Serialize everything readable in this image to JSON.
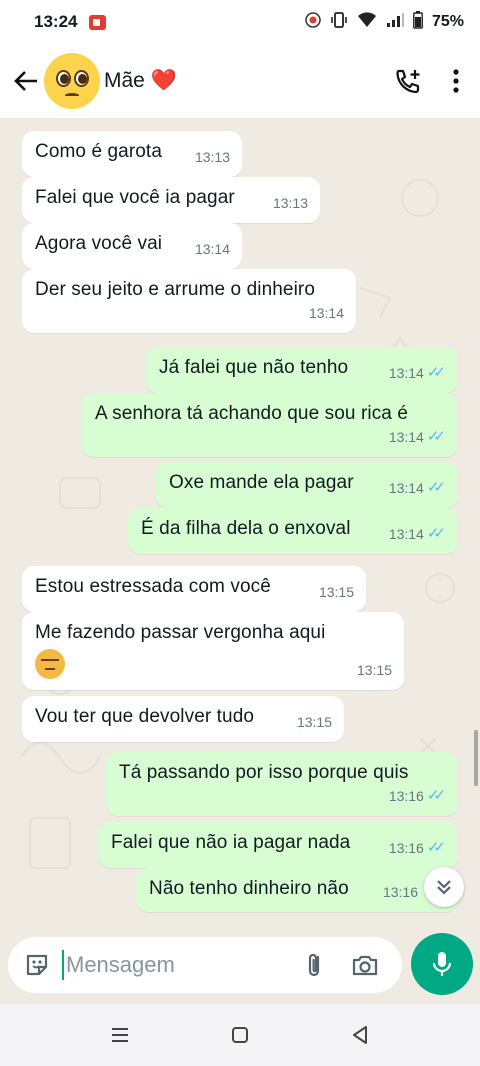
{
  "status_bar": {
    "time": "13:24",
    "battery": "75%"
  },
  "header": {
    "contact_name": "Mãe ❤️"
  },
  "messages": [
    {
      "dir": "in",
      "text": "Como é garota",
      "time": "13:13"
    },
    {
      "dir": "in",
      "text": "Falei que você ia pagar",
      "time": "13:13"
    },
    {
      "dir": "in",
      "text": "Agora você vai",
      "time": "13:14"
    },
    {
      "dir": "in",
      "text": "Der seu jeito e arrume o dinheiro",
      "time": "13:14"
    },
    {
      "dir": "out",
      "text": "Já falei que não tenho",
      "time": "13:14",
      "status": "read"
    },
    {
      "dir": "out",
      "text": "A senhora tá achando que sou rica é",
      "time": "13:14",
      "status": "read"
    },
    {
      "dir": "out",
      "text": "Oxe mande ela pagar",
      "time": "13:14",
      "status": "read"
    },
    {
      "dir": "out",
      "text": "É da filha dela o enxoval",
      "time": "13:14",
      "status": "read"
    },
    {
      "dir": "in",
      "text": "Estou estressada com você",
      "time": "13:15"
    },
    {
      "dir": "in",
      "text": "Me fazendo passar vergonha aqui",
      "emoji": "unamused-face",
      "time": "13:15"
    },
    {
      "dir": "in",
      "text": "Vou ter que devolver tudo",
      "time": "13:15"
    },
    {
      "dir": "out",
      "text": "Tá passando por isso porque quis",
      "time": "13:16",
      "status": "read"
    },
    {
      "dir": "out",
      "text": "Falei que não ia pagar nada",
      "time": "13:16",
      "status": "read"
    },
    {
      "dir": "out",
      "text": "Não tenho dinheiro não",
      "time": "13:16",
      "status": "read"
    }
  ],
  "composer": {
    "placeholder": "Mensagem"
  },
  "colors": {
    "accent": "#00a884",
    "outgoing_bubble": "#d9fdd3",
    "incoming_bubble": "#ffffff",
    "read_ticks": "#53bdeb",
    "chat_bg": "#efeae2"
  }
}
